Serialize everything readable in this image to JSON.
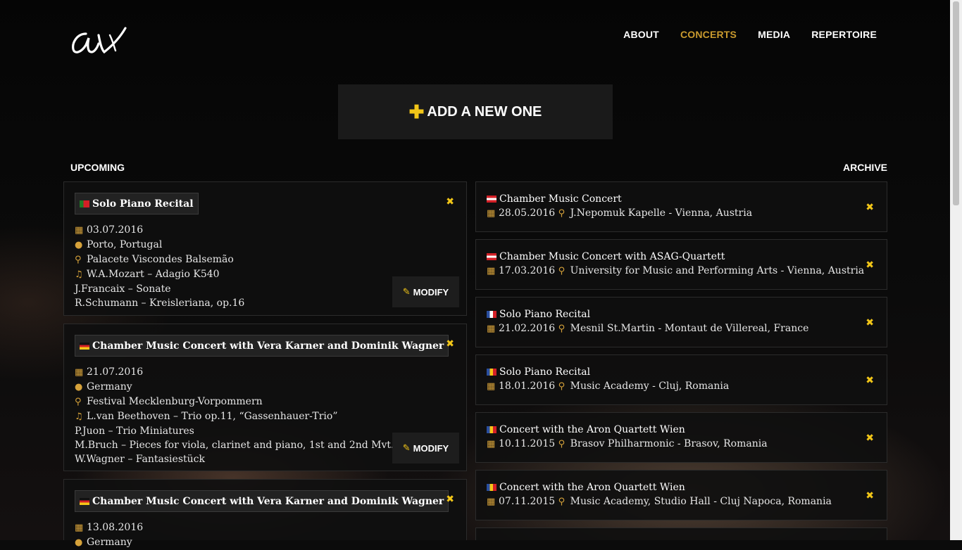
{
  "header": {
    "logo_text": "av",
    "nav": [
      {
        "label": "ABOUT",
        "active": false
      },
      {
        "label": "CONCERTS",
        "active": true
      },
      {
        "label": "MEDIA",
        "active": false
      },
      {
        "label": "REPERTOIRE",
        "active": false
      }
    ]
  },
  "add_button": {
    "label": "ADD A NEW ONE",
    "icon": "plus-icon"
  },
  "sections": {
    "upcoming": "UPCOMING",
    "archive": "ARCHIVE"
  },
  "modify_label": "MODIFY",
  "upcoming": [
    {
      "flag": "pt",
      "title": "Solo Piano Recital",
      "date": "03.07.2016",
      "location": "Porto, Portugal",
      "venue": "Palacete Viscondes Balsemão",
      "program": [
        "W.A.Mozart – Adagio K540",
        "J.Francaix – Sonate",
        "R.Schumann – Kreisleriana, op.16"
      ]
    },
    {
      "flag": "de",
      "title": "Chamber Music Concert with Vera Karner and Dominik Wagner",
      "date": "21.07.2016",
      "location": "Germany",
      "venue": "Festival Mecklenburg-Vorpommern",
      "program": [
        "L.van Beethoven – Trio op.11, “Gassenhauer-Trio”",
        "P.Juon – Trio Miniatures",
        "M.Bruch – Pieces for viola, clarinet and piano, 1st and 2nd Mvt.",
        "W.Wagner – Fantasiestück"
      ]
    },
    {
      "flag": "de",
      "title": "Chamber Music Concert with Vera Karner and Dominik Wagner",
      "date": "13.08.2016",
      "location": "Germany"
    }
  ],
  "archive": [
    {
      "flag": "at",
      "title": "Chamber Music Concert",
      "date": "28.05.2016",
      "place": "J.Nepomuk Kapelle - Vienna, Austria"
    },
    {
      "flag": "at",
      "title": "Chamber Music Concert with ASAG-Quartett",
      "date": "17.03.2016",
      "place": "University for Music and Performing Arts - Vienna, Austria"
    },
    {
      "flag": "fr",
      "title": "Solo Piano Recital",
      "date": "21.02.2016",
      "place": "Mesnil St.Martin - Montaut de Villereal, France"
    },
    {
      "flag": "ro",
      "title": "Solo Piano Recital",
      "date": "18.01.2016",
      "place": "Music Academy - Cluj, Romania"
    },
    {
      "flag": "ro",
      "title": "Concert with the Aron Quartett Wien",
      "date": "10.11.2015",
      "place": "Brasov Philharmonic - Brasov, Romania"
    },
    {
      "flag": "ro",
      "title": "Concert with the Aron Quartett Wien",
      "date": "07.11.2015",
      "place": "Music Academy, Studio Hall - Cluj Napoca, Romania"
    }
  ],
  "colors": {
    "accent": "#f2c618",
    "nav_active": "#c99a2e",
    "icon": "#d6a23a"
  }
}
